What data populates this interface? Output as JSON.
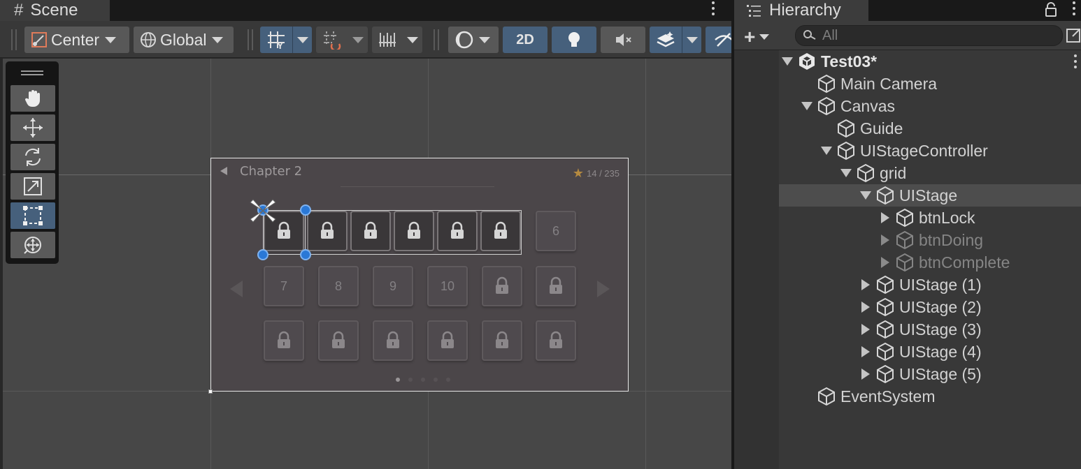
{
  "scene": {
    "tab_label": "Scene",
    "toolbar": {
      "pivot_label": "Center",
      "space_label": "Global",
      "mode_2d_label": "2D"
    },
    "tools": [
      "hand-tool",
      "move-tool",
      "rotate-tool",
      "scale-tool",
      "rect-tool",
      "transform-tool"
    ],
    "active_tool": "rect-tool"
  },
  "game": {
    "chapter_title": "Chapter 2",
    "star_count": "14 / 235",
    "row1": [
      "",
      "",
      "",
      "",
      "",
      "",
      "6"
    ],
    "row2": [
      "7",
      "8",
      "9",
      "10",
      "",
      ""
    ],
    "row3": [
      "",
      "",
      "",
      "",
      "",
      ""
    ],
    "page_dots": 5,
    "active_page": 1
  },
  "hierarchy": {
    "tab_label": "Hierarchy",
    "search_placeholder": "All",
    "items": [
      {
        "label": "Test03*",
        "depth": 0,
        "expanded": true,
        "kind": "scene"
      },
      {
        "label": "Main Camera",
        "depth": 1,
        "expanded": null
      },
      {
        "label": "Canvas",
        "depth": 1,
        "expanded": true
      },
      {
        "label": "Guide",
        "depth": 2,
        "expanded": null
      },
      {
        "label": "UIStageController",
        "depth": 2,
        "expanded": true
      },
      {
        "label": "grid",
        "depth": 3,
        "expanded": true
      },
      {
        "label": "UIStage",
        "depth": 4,
        "expanded": true,
        "selected": true
      },
      {
        "label": "btnLock",
        "depth": 5,
        "expanded": false
      },
      {
        "label": "btnDoing",
        "depth": 5,
        "expanded": false,
        "inactive": true
      },
      {
        "label": "btnComplete",
        "depth": 5,
        "expanded": false,
        "inactive": true
      },
      {
        "label": "UIStage (1)",
        "depth": 4,
        "expanded": false
      },
      {
        "label": "UIStage (2)",
        "depth": 4,
        "expanded": false
      },
      {
        "label": "UIStage (3)",
        "depth": 4,
        "expanded": false
      },
      {
        "label": "UIStage (4)",
        "depth": 4,
        "expanded": false
      },
      {
        "label": "UIStage (5)",
        "depth": 4,
        "expanded": false
      },
      {
        "label": "EventSystem",
        "depth": 1,
        "expanded": null
      }
    ]
  },
  "colors": {
    "accent_blue": "#46607c",
    "selection_handle": "#2a78d6",
    "star": "#b58a40"
  }
}
